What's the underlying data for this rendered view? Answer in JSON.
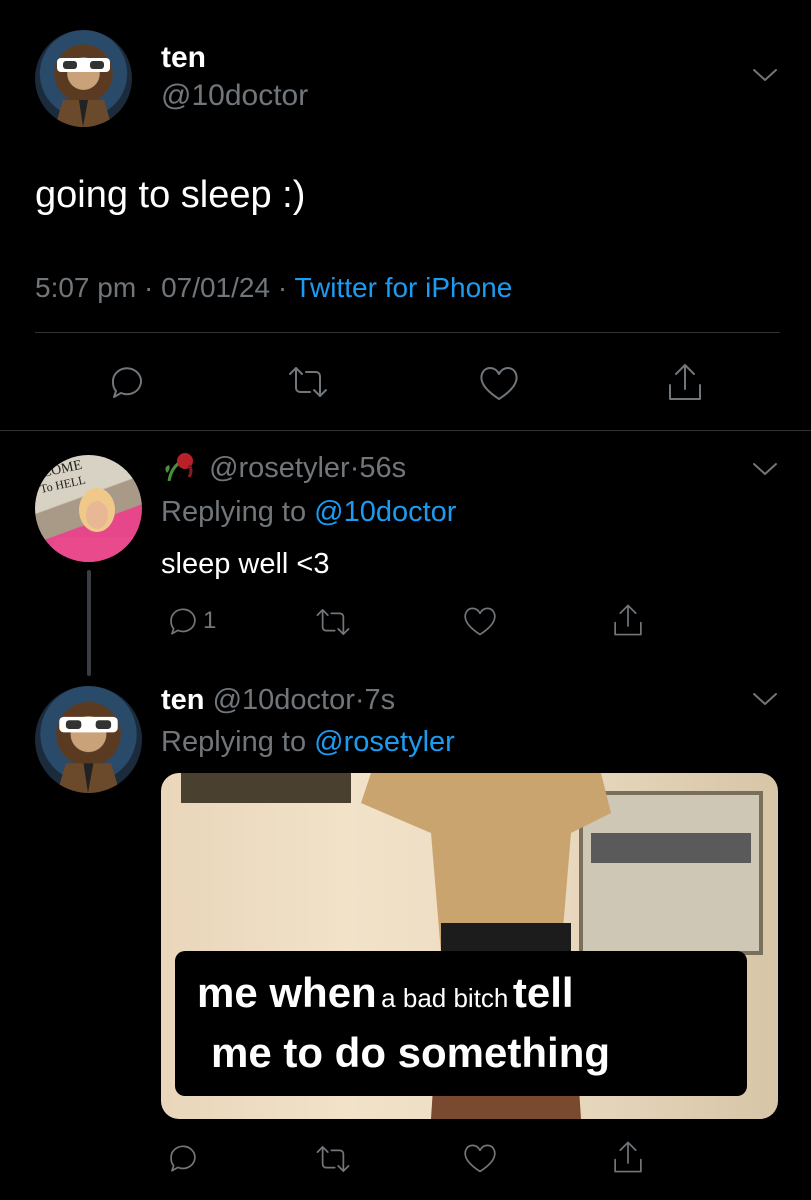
{
  "main_tweet": {
    "display_name": "ten",
    "handle": "@10doctor",
    "text": "going to sleep :)",
    "time": "5:07 pm",
    "date": "07/01/24",
    "source": "Twitter for iPhone",
    "sep": "·"
  },
  "reply_1": {
    "handle": "@rosetyler",
    "age": "56s",
    "replying_prefix": "Replying to ",
    "replying_to": "@10doctor",
    "text": "sleep well <3",
    "reply_count": "1",
    "sep": "·"
  },
  "reply_2": {
    "display_name": "ten",
    "handle": "@10doctor",
    "age": "7s",
    "replying_prefix": "Replying to ",
    "replying_to": "@rosetyler",
    "meme": {
      "line1_big_a": "me when",
      "line1_small": "a bad bitch",
      "line1_big_b": "tell",
      "line2": "me to do something"
    },
    "sep": "·"
  },
  "colors": {
    "background": "#000000",
    "muted": "#71767b",
    "link_blue": "#1d9bf0",
    "divider": "#2f3336"
  }
}
